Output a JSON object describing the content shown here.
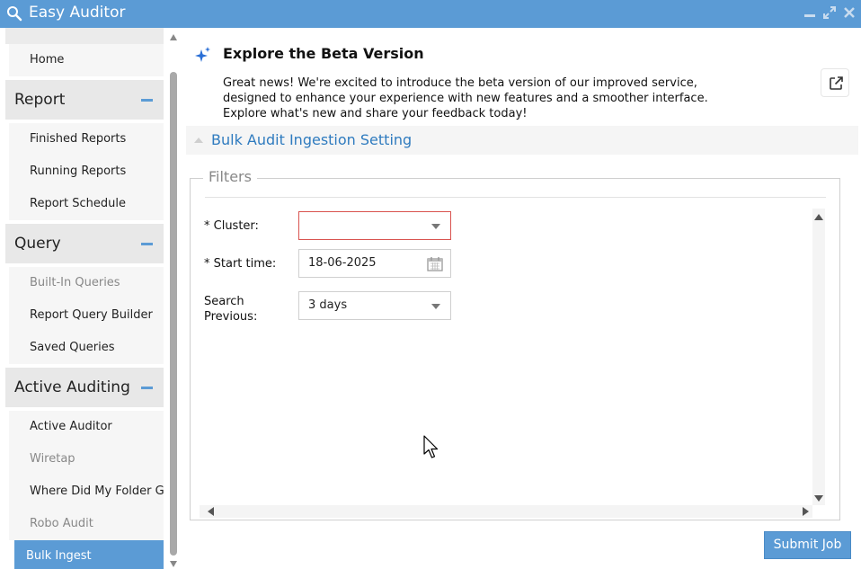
{
  "app": {
    "title": "Easy Auditor"
  },
  "window_controls": [
    "minimize-icon",
    "maximize-icon",
    "close-icon"
  ],
  "sidebar": {
    "home": "Home",
    "groups": [
      {
        "title": "Report",
        "items": [
          "Finished Reports",
          "Running Reports",
          "Report Schedule"
        ]
      },
      {
        "title": "Query",
        "items": [
          "Built-In Queries",
          "Report Query Builder",
          "Saved Queries"
        ]
      },
      {
        "title": "Active Auditing",
        "items": [
          "Active Auditor",
          "Wiretap",
          "Where Did My Folder Go?",
          "Robo Audit",
          "Bulk Ingest"
        ]
      }
    ],
    "active_item": "Bulk Ingest"
  },
  "banner": {
    "title": "Explore the Beta Version",
    "text": "Great news! We're excited to introduce the beta version of our improved service, designed to enhance your experience with new features and a smoother interface. Explore what's new and share your feedback today!"
  },
  "section": {
    "title": "Bulk Audit Ingestion Setting"
  },
  "filters": {
    "legend": "Filters",
    "cluster_label": "* Cluster:",
    "cluster_value": "",
    "start_time_label": "* Start time:",
    "start_time_value": "18-06-2025",
    "search_previous_label_1": "Search",
    "search_previous_label_2": "Previous:",
    "search_previous_value": "3 days"
  },
  "actions": {
    "submit": "Submit Job"
  },
  "colors": {
    "accent": "#5b9bd5",
    "error_border": "#d9534f",
    "link": "#2f7bbf"
  }
}
